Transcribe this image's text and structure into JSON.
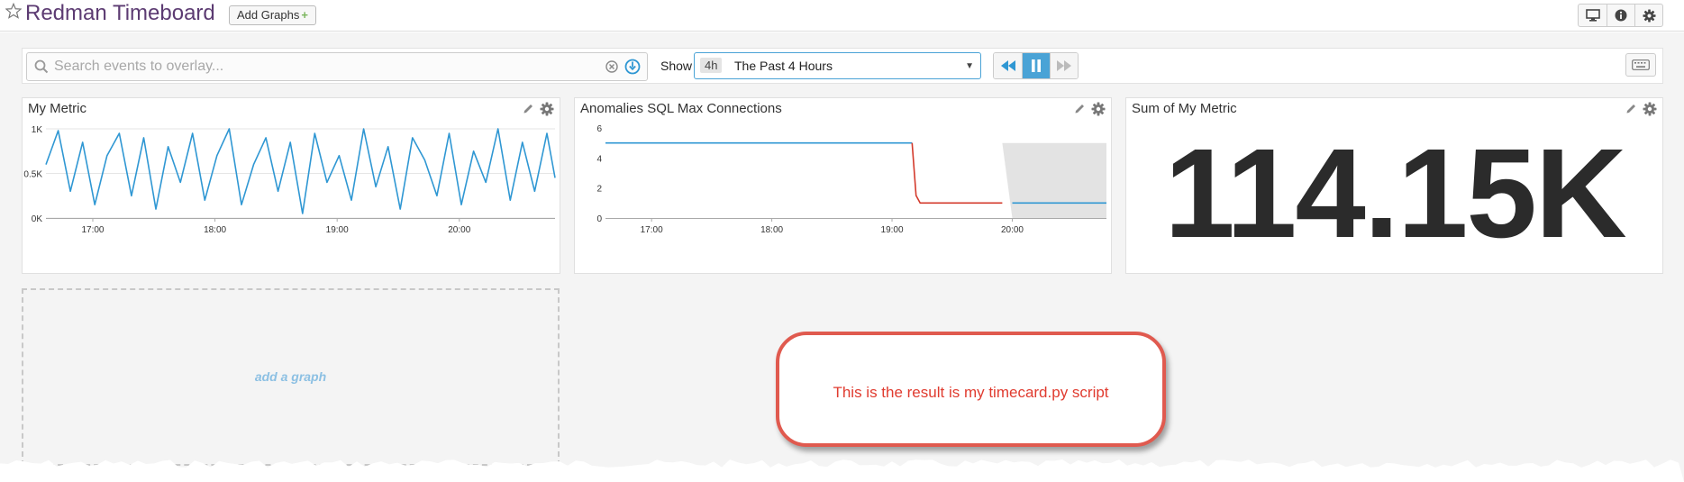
{
  "header": {
    "title": "Redman Timeboard",
    "add_graphs_label": "Add Graphs",
    "add_graphs_plus": "+",
    "icons": [
      "desktop-icon",
      "info-icon",
      "gear-icon"
    ]
  },
  "toolbar": {
    "search_placeholder": "Search events to overlay...",
    "show_label": "Show",
    "time_abbr": "4h",
    "time_text": "The Past 4 Hours",
    "playback_icons": [
      "rewind-icon",
      "pause-icon",
      "fast-forward-icon"
    ],
    "active_playback": "pause-icon"
  },
  "widgets": {
    "my_metric": {
      "title": "My Metric"
    },
    "anomalies": {
      "title": "Anomalies SQL Max Connections"
    },
    "sum": {
      "title": "Sum of My Metric",
      "value": "114.15K"
    }
  },
  "add_graph_label": "add a graph",
  "callout_text": "This is the result is my timecard.py script",
  "colors": {
    "title": "#5c3b72",
    "series_blue": "#2f97d3",
    "anomaly_red": "#d33a2c",
    "band_gray": "#e3e3e3",
    "accent": "#4aa3d6",
    "callout_border": "#e05a4f"
  },
  "chart_data": [
    {
      "type": "line",
      "title": "My Metric",
      "x": [
        "16:37",
        "16:43",
        "16:49",
        "16:55",
        "17:01",
        "17:07",
        "17:13",
        "17:19",
        "17:25",
        "17:31",
        "17:37",
        "17:43",
        "17:49",
        "17:55",
        "18:01",
        "18:07",
        "18:13",
        "18:19",
        "18:25",
        "18:31",
        "18:37",
        "18:43",
        "18:49",
        "18:55",
        "19:01",
        "19:07",
        "19:13",
        "19:19",
        "19:25",
        "19:31",
        "19:37",
        "19:43",
        "19:49",
        "19:55",
        "20:01",
        "20:07",
        "20:13",
        "20:19",
        "20:25",
        "20:31",
        "20:37",
        "20:43",
        "20:47"
      ],
      "series": [
        {
          "values": [
            600,
            980,
            300,
            850,
            150,
            700,
            950,
            250,
            900,
            100,
            800,
            400,
            950,
            200,
            700,
            1000,
            150,
            600,
            900,
            300,
            850,
            50,
            950,
            400,
            700,
            200,
            1000,
            350,
            800,
            100,
            900,
            650,
            250,
            950,
            150,
            750,
            400,
            1000,
            200,
            850,
            300,
            950,
            450
          ]
        }
      ],
      "x_ticks": [
        "17:00",
        "18:00",
        "19:00",
        "20:00"
      ],
      "y_ticks": [
        "0K",
        "0.5K",
        "1K"
      ],
      "ylim": [
        0,
        1000
      ],
      "grid": "horizontal"
    },
    {
      "type": "line",
      "title": "Anomalies SQL Max Connections",
      "x": [
        "16:37",
        "19:10",
        "19:12",
        "19:14",
        "19:55",
        "20:00",
        "20:47"
      ],
      "series": [
        {
          "values": [
            5,
            5,
            null,
            null,
            null,
            1,
            1
          ]
        },
        {
          "values": [
            null,
            5,
            1.5,
            1,
            1,
            null,
            null
          ]
        }
      ],
      "band": {
        "x": [
          "19:10",
          "19:55",
          "20:00",
          "20:47"
        ],
        "upper": [
          5,
          5,
          5,
          5
        ],
        "lower": [
          5,
          5,
          0,
          0
        ]
      },
      "x_ticks": [
        "17:00",
        "18:00",
        "19:00",
        "20:00"
      ],
      "y_ticks": [
        "0",
        "2",
        "4",
        "6"
      ],
      "ylim": [
        0,
        6
      ],
      "grid": "none"
    }
  ]
}
